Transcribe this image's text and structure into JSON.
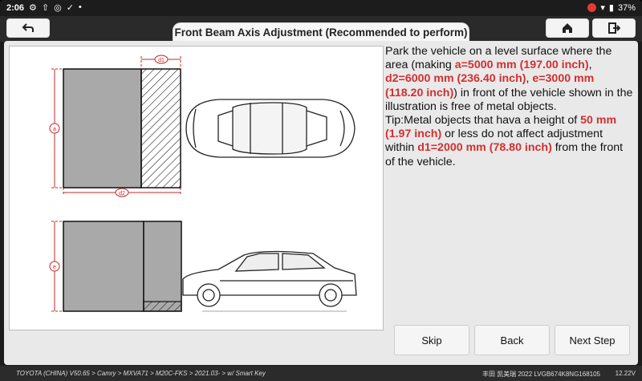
{
  "status_bar": {
    "time": "2:06",
    "battery": "37%"
  },
  "header": {
    "title": "Front Beam Axis Adjustment (Recommended to perform)"
  },
  "diagram": {
    "label_d1": "d1",
    "label_d2": "d2",
    "label_a": "a",
    "label_e": "e"
  },
  "description": {
    "p1": "Park the vehicle on a level surface where the area (making ",
    "hl_a": "a=5000 mm (197.00 inch)",
    "c1": ", ",
    "hl_d2": "d2=6000 mm (236.40 inch)",
    "c2": ", ",
    "hl_e": "e=3000 mm (118.20 inch)",
    "p2": ") in front of the vehicle shown in the illustration is free of metal objects.",
    "tip1": "Tip:Metal objects that hava a height of ",
    "hl_h": "50 mm (1.97 inch)",
    "tip2": " or less do not affect adjustment within ",
    "hl_d1": "d1=2000 mm (78.80 inch)",
    "tip3": " from the front of the vehicle."
  },
  "buttons": {
    "skip": "Skip",
    "back": "Back",
    "next": "Next Step"
  },
  "footer": {
    "path": "TOYOTA (CHINA) V50.65 > Camry > MXVA71 > M20C-FKS > 2021.03- > w/ Smart Key",
    "vehicle": "丰田 凯美瑞 2022  LVGB674K8NG168105",
    "voltage": "12.22V"
  },
  "colors": {
    "highlight": "#d32f2f",
    "accent_red": "#e53935"
  }
}
